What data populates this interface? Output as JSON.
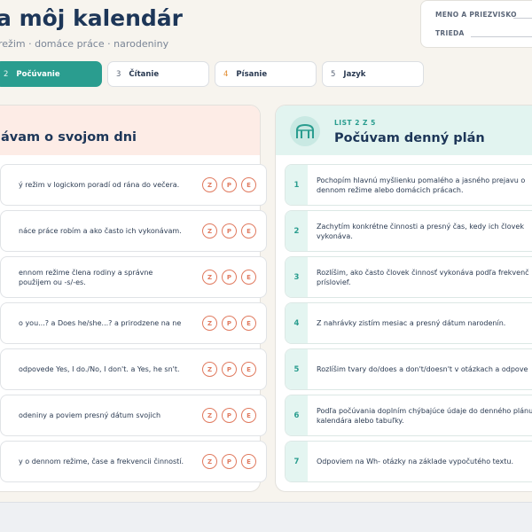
{
  "header": {
    "title": "a môj kalendár",
    "subtitle": "režim · domáce práce · narodeniny"
  },
  "name_box": {
    "name_label": "MENO A PRIEZVISKO",
    "class_label": "TRIEDA"
  },
  "tabs": [
    {
      "num": "2",
      "label": "Počúvanie",
      "active": true
    },
    {
      "num": "3",
      "label": "Čítanie",
      "active": false
    },
    {
      "num": "4",
      "label": "Písanie",
      "active": false,
      "num_color": "#e08a2c"
    },
    {
      "num": "5",
      "label": "Jazyk",
      "active": false
    }
  ],
  "left_panel": {
    "title": "ávam o svojom dni",
    "circle_labels": [
      "Z",
      "P",
      "E"
    ],
    "items": [
      {
        "text": "ý režim v logickom poradí od rána do večera."
      },
      {
        "text": "náce práce robím a ako často ich vykonávam."
      },
      {
        "text": "ennom režime člena rodiny a správne použijem ou -s/-es."
      },
      {
        "text": "o you...? a Does he/she...? a prirodzene na ne"
      },
      {
        "text": "odpovede Yes, I do./No, I don't. a Yes, he sn't."
      },
      {
        "text": "odeniny a poviem presný dátum svojich"
      },
      {
        "text": "y o dennom režime, čase a frekvencii činností."
      }
    ]
  },
  "right_panel": {
    "sheet_label": "LIST 2 Z 5",
    "title": "Počúvam denný plán",
    "icon": "arch-icon",
    "items": [
      {
        "num": "1",
        "text": "Pochopím hlavnú myšlienku pomalého a jasného prejavu o dennom režime alebo domácich prácach."
      },
      {
        "num": "2",
        "text": "Zachytím konkrétne činnosti a presný čas, kedy ich človek vykonáva."
      },
      {
        "num": "3",
        "text": "Rozlíšim, ako často človek činnosť vykonáva podľa frekvenč príslovief."
      },
      {
        "num": "4",
        "text": "Z nahrávky zistím mesiac a presný dátum narodenín."
      },
      {
        "num": "5",
        "text": "Rozlíšim tvary do/does a don't/doesn't v otázkach a odpove"
      },
      {
        "num": "6",
        "text": "Podľa počúvania doplním chýbajúce údaje do denného plánu kalendára alebo tabuľky."
      },
      {
        "num": "7",
        "text": "Odpoviem na Wh- otázky na základe vypočutého textu."
      }
    ]
  },
  "colors": {
    "accent": "#2a9d8f",
    "coral": "#e07a5f",
    "navy": "#1d3658"
  }
}
